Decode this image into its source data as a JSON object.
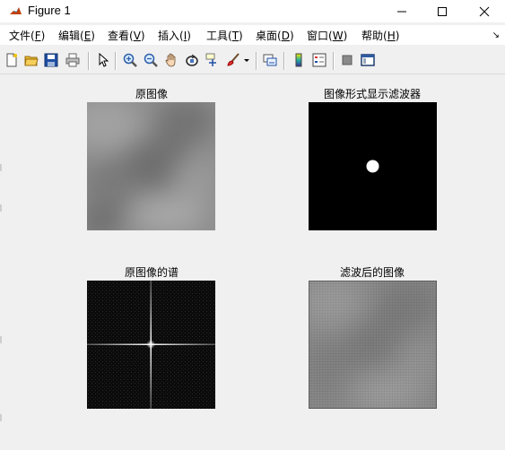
{
  "window": {
    "title": "Figure 1",
    "controls": [
      "minimize",
      "maximize",
      "close"
    ]
  },
  "menu": {
    "items": [
      {
        "label": "文件(",
        "key": "F",
        "end": ")"
      },
      {
        "label": "编辑(",
        "key": "E",
        "end": ")"
      },
      {
        "label": "查看(",
        "key": "V",
        "end": ")"
      },
      {
        "label": "插入(",
        "key": "I",
        "end": ")"
      },
      {
        "label": "工具(",
        "key": "T",
        "end": ")"
      },
      {
        "label": "桌面(",
        "key": "D",
        "end": ")"
      },
      {
        "label": "窗口(",
        "key": "W",
        "end": ")"
      },
      {
        "label": "帮助(",
        "key": "H",
        "end": ")"
      }
    ],
    "overflow_arrow": "↘"
  },
  "toolbar": {
    "icons": [
      "new-figure-icon",
      "open-file-icon",
      "save-icon",
      "print-icon",
      "pointer-icon",
      "zoom-in-icon",
      "zoom-out-icon",
      "pan-hand-icon",
      "rotate-3d-icon",
      "data-cursor-icon",
      "brush-icon",
      "brush-dropdown-icon",
      "link-plot-icon",
      "colorbar-icon",
      "legend-icon",
      "hide-plot-tools-icon",
      "show-plot-tools-icon"
    ]
  },
  "subplots": {
    "original": {
      "title": "原图像"
    },
    "filter": {
      "title": "图像形式显示滤波器"
    },
    "spectrum": {
      "title": "原图像的谱"
    },
    "filtered": {
      "title": "滤波后的图像"
    }
  },
  "colors": {
    "titlebar_bg": "#ffffff",
    "figure_bg": "#f0f0f0",
    "image_bg_dark": "#000000"
  }
}
